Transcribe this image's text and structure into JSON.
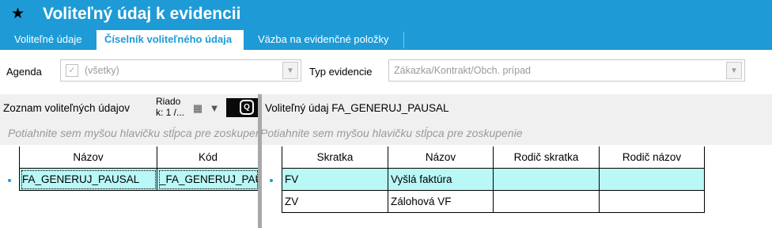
{
  "window": {
    "title": "Voliteľný údaj k evidencii",
    "icon": "star-icon"
  },
  "tabs": [
    {
      "label": "Voliteľné údaje",
      "active": false
    },
    {
      "label": "Číselník voliteľného údaja",
      "active": true
    },
    {
      "label": "Väzba na evidenčné položky",
      "active": false
    }
  ],
  "filters": {
    "agenda_label": "Agenda",
    "agenda_value": "(všetky)",
    "agenda_checked": true,
    "typ_label": "Typ evidencie",
    "typ_value": "Zákazka/Kontrakt/Obch. prípad"
  },
  "left": {
    "title": "Zoznam voliteľných údajov",
    "rows_info_line1": "Riado",
    "rows_info_line2": "k: 1 /...",
    "group_hint": "Potiahnite sem myšou hlavičku stĺpca pre zoskupenie",
    "columns": [
      "Názov",
      "Kód"
    ],
    "rows": [
      [
        "FA_GENERUJ_PAUSAL",
        "_FA_GENERUJ_PAUSAL"
      ]
    ]
  },
  "right": {
    "title": "Voliteľný údaj FA_GENERUJ_PAUSAL",
    "group_hint": "Potiahnite sem myšou hlavičku stĺpca pre zoskupenie",
    "columns": [
      "Skratka",
      "Názov",
      "Rodič skratka",
      "Rodič názov"
    ],
    "rows": [
      [
        "FV",
        "Vyšlá faktúra",
        "",
        ""
      ],
      [
        "ZV",
        "Zálohová VF",
        "",
        ""
      ]
    ]
  },
  "colors": {
    "accent": "#1e9bd7",
    "selected_row": "#baf7f7"
  }
}
